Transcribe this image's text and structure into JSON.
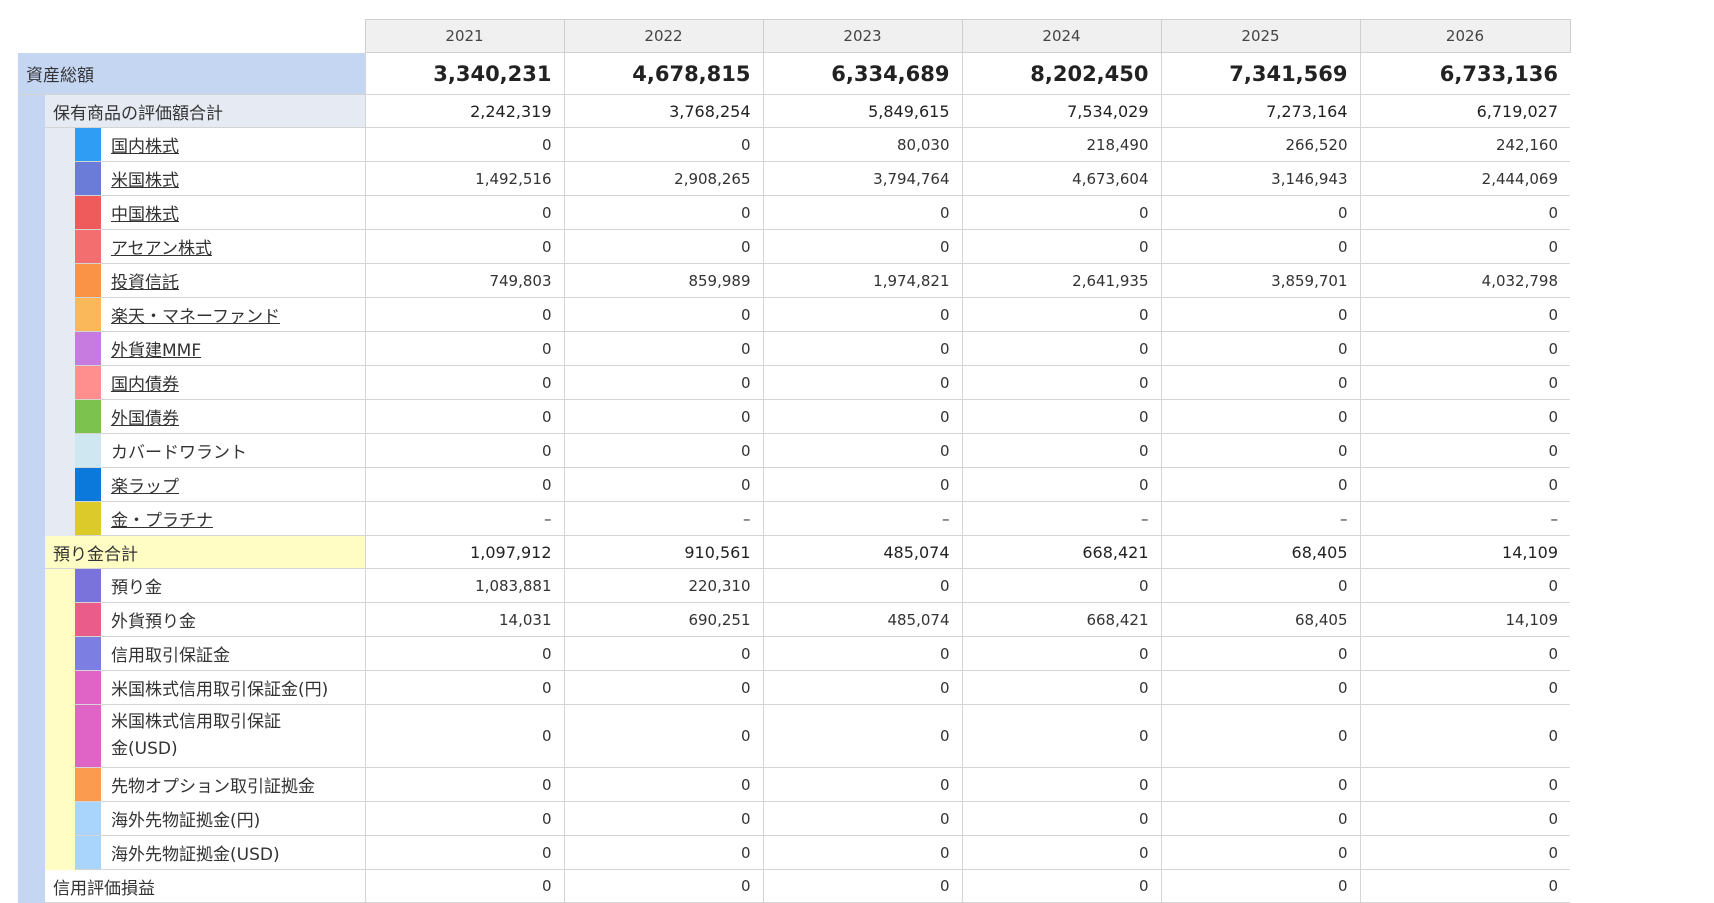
{
  "years": [
    "2021",
    "2022",
    "2023",
    "2024",
    "2025",
    "2026"
  ],
  "total": {
    "label": "資産総額",
    "values": [
      "3,340,231",
      "4,678,815",
      "6,334,689",
      "8,202,450",
      "7,341,569",
      "6,733,136"
    ]
  },
  "holdings": {
    "label": "保有商品の評価額合計",
    "values": [
      "2,242,319",
      "3,768,254",
      "5,849,615",
      "7,534,029",
      "7,273,164",
      "6,719,027"
    ],
    "items": [
      {
        "label": "国内株式",
        "link": true,
        "color": "#2f9df4",
        "values": [
          "0",
          "0",
          "80,030",
          "218,490",
          "266,520",
          "242,160"
        ]
      },
      {
        "label": "米国株式",
        "link": true,
        "color": "#6b7bd8",
        "values": [
          "1,492,516",
          "2,908,265",
          "3,794,764",
          "4,673,604",
          "3,146,943",
          "2,444,069"
        ]
      },
      {
        "label": "中国株式",
        "link": true,
        "color": "#ef5b5b",
        "values": [
          "0",
          "0",
          "0",
          "0",
          "0",
          "0"
        ]
      },
      {
        "label": "アセアン株式",
        "link": true,
        "color": "#f36f6f",
        "values": [
          "0",
          "0",
          "0",
          "0",
          "0",
          "0"
        ]
      },
      {
        "label": "投資信託",
        "link": true,
        "color": "#fb9347",
        "values": [
          "749,803",
          "859,989",
          "1,974,821",
          "2,641,935",
          "3,859,701",
          "4,032,798"
        ]
      },
      {
        "label": "楽天・マネーファンド",
        "link": true,
        "color": "#fbb85a",
        "values": [
          "0",
          "0",
          "0",
          "0",
          "0",
          "0"
        ]
      },
      {
        "label": "外貨建MMF",
        "link": true,
        "color": "#c77be0",
        "values": [
          "0",
          "0",
          "0",
          "0",
          "0",
          "0"
        ]
      },
      {
        "label": "国内債券",
        "link": true,
        "color": "#ff8f8f",
        "values": [
          "0",
          "0",
          "0",
          "0",
          "0",
          "0"
        ]
      },
      {
        "label": "外国債券",
        "link": true,
        "color": "#7cc24e",
        "values": [
          "0",
          "0",
          "0",
          "0",
          "0",
          "0"
        ]
      },
      {
        "label": "カバードワラント",
        "link": false,
        "color": "#cfe7f1",
        "values": [
          "0",
          "0",
          "0",
          "0",
          "0",
          "0"
        ]
      },
      {
        "label": "楽ラップ",
        "link": true,
        "color": "#0a79db",
        "values": [
          "0",
          "0",
          "0",
          "0",
          "0",
          "0"
        ]
      },
      {
        "label": "金・プラチナ",
        "link": true,
        "color": "#dcc92a",
        "values": [
          "–",
          "–",
          "–",
          "–",
          "–",
          "–"
        ]
      }
    ]
  },
  "deposits": {
    "label": "預り金合計",
    "values": [
      "1,097,912",
      "910,561",
      "485,074",
      "668,421",
      "68,405",
      "14,109"
    ],
    "items": [
      {
        "label": "預り金",
        "color": "#7a73dc",
        "values": [
          "1,083,881",
          "220,310",
          "0",
          "0",
          "0",
          "0"
        ]
      },
      {
        "label": "外貨預り金",
        "color": "#ea5c8a",
        "values": [
          "14,031",
          "690,251",
          "485,074",
          "668,421",
          "68,405",
          "14,109"
        ]
      },
      {
        "label": "信用取引保証金",
        "color": "#7c7fe1",
        "values": [
          "0",
          "0",
          "0",
          "0",
          "0",
          "0"
        ]
      },
      {
        "label": "米国株式信用取引保証金(円)",
        "color": "#e064c6",
        "values": [
          "0",
          "0",
          "0",
          "0",
          "0",
          "0"
        ]
      },
      {
        "label": "米国株式信用取引保証金(USD)",
        "color": "#e064c6",
        "values": [
          "0",
          "0",
          "0",
          "0",
          "0",
          "0"
        ],
        "tall": true
      },
      {
        "label": "先物オプション取引証拠金",
        "color": "#fb9b50",
        "values": [
          "0",
          "0",
          "0",
          "0",
          "0",
          "0"
        ]
      },
      {
        "label": "海外先物証拠金(円)",
        "color": "#a9d4fb",
        "values": [
          "0",
          "0",
          "0",
          "0",
          "0",
          "0"
        ]
      },
      {
        "label": "海外先物証拠金(USD)",
        "color": "#a9d4fb",
        "values": [
          "0",
          "0",
          "0",
          "0",
          "0",
          "0"
        ]
      }
    ]
  },
  "credit": {
    "label": "信用評価損益",
    "values": [
      "0",
      "0",
      "0",
      "0",
      "0",
      "0"
    ]
  }
}
